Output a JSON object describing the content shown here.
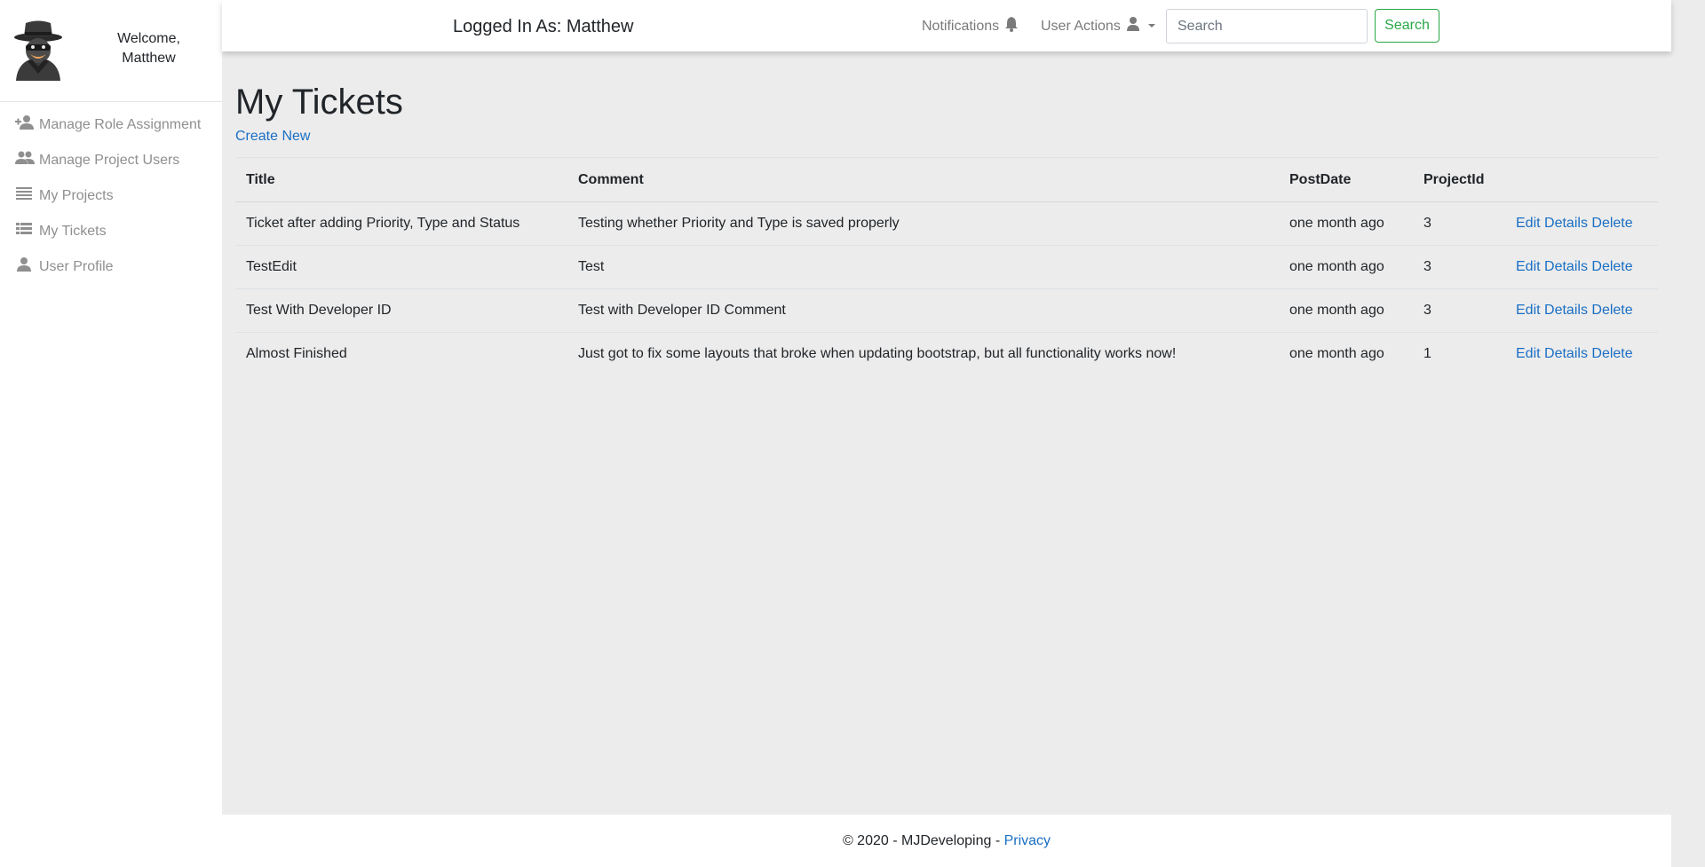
{
  "sidebar": {
    "welcome": "Welcome,",
    "user_name": "Matthew",
    "items": [
      {
        "label": "Manage Role Assignment",
        "icon": "person-add-icon"
      },
      {
        "label": "Manage Project Users",
        "icon": "people-icon"
      },
      {
        "label": "My Projects",
        "icon": "list-icon"
      },
      {
        "label": "My Tickets",
        "icon": "view-list-icon"
      },
      {
        "label": "User Profile",
        "icon": "person-icon"
      }
    ]
  },
  "header": {
    "logged_in": "Logged In As: Matthew",
    "notifications": "Notifications",
    "user_actions": "User Actions",
    "search_placeholder": "Search",
    "search_button": "Search"
  },
  "main": {
    "title": "My Tickets",
    "create_new": "Create New",
    "columns": [
      "Title",
      "Comment",
      "PostDate",
      "ProjectId"
    ],
    "rows": [
      {
        "title": "Ticket after adding Priority, Type and Status",
        "comment": "Testing whether Priority and Type is saved properly",
        "postdate": "one month ago",
        "projectid": "3"
      },
      {
        "title": "TestEdit",
        "comment": "Test",
        "postdate": "one month ago",
        "projectid": "3"
      },
      {
        "title": "Test With Developer ID",
        "comment": "Test with Developer ID Comment",
        "postdate": "one month ago",
        "projectid": "3"
      },
      {
        "title": "Almost Finished",
        "comment": "Just got to fix some layouts that broke when updating bootstrap, but all functionality works now!",
        "postdate": "one month ago",
        "projectid": "1"
      }
    ],
    "actions": {
      "edit": "Edit",
      "details": "Details",
      "delete": "Delete"
    }
  },
  "footer": {
    "copyright": "© 2020 - MJDeveloping - ",
    "privacy": "Privacy"
  },
  "colors": {
    "link": "#1a6fc4",
    "success": "#28a745",
    "background": "#ececec",
    "nav_text": "#8f8f8f"
  }
}
